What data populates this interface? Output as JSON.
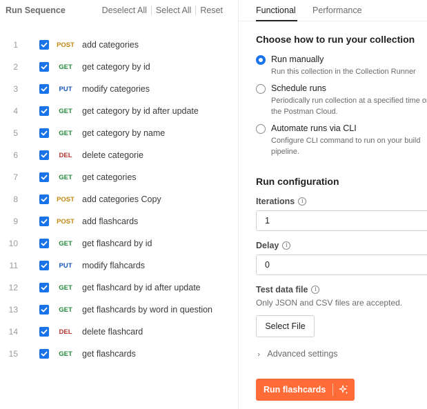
{
  "left": {
    "title": "Run Sequence",
    "deselect_all": "Deselect All",
    "select_all": "Select All",
    "reset": "Reset",
    "requests": [
      {
        "num": "1",
        "method": "POST",
        "name": "add categories"
      },
      {
        "num": "2",
        "method": "GET",
        "name": "get category by id"
      },
      {
        "num": "3",
        "method": "PUT",
        "name": "modify categories"
      },
      {
        "num": "4",
        "method": "GET",
        "name": "get category by id after update"
      },
      {
        "num": "5",
        "method": "GET",
        "name": "get category by name"
      },
      {
        "num": "6",
        "method": "DEL",
        "name": "delete categorie"
      },
      {
        "num": "7",
        "method": "GET",
        "name": "get categories"
      },
      {
        "num": "8",
        "method": "POST",
        "name": "add categories Copy"
      },
      {
        "num": "9",
        "method": "POST",
        "name": "add flashcards"
      },
      {
        "num": "10",
        "method": "GET",
        "name": "get flashcard by id"
      },
      {
        "num": "11",
        "method": "PUT",
        "name": "modify flahcards"
      },
      {
        "num": "12",
        "method": "GET",
        "name": "get flashcard by id after update"
      },
      {
        "num": "13",
        "method": "GET",
        "name": "get flashcards by word in question"
      },
      {
        "num": "14",
        "method": "DEL",
        "name": "delete flashcard"
      },
      {
        "num": "15",
        "method": "GET",
        "name": "get flashcards"
      }
    ]
  },
  "right": {
    "tabs": [
      "Functional",
      "Performance"
    ],
    "choose_title": "Choose how to run your collection",
    "options": [
      {
        "label": "Run manually",
        "desc": [
          "Run this collection in the Collection Runner"
        ],
        "selected": true
      },
      {
        "label": "Schedule runs",
        "desc": [
          "Periodically run collection at a specified time on",
          "the Postman Cloud."
        ],
        "selected": false
      },
      {
        "label": "Automate runs via CLI",
        "desc": [
          "Configure CLI command to run on your build",
          "pipeline."
        ],
        "selected": false
      }
    ],
    "config_title": "Run configuration",
    "iterations_label": "Iterations",
    "iterations_value": "1",
    "delay_label": "Delay",
    "delay_value": "0",
    "test_data_label": "Test data file",
    "test_data_help": "Only JSON and CSV files are accepted.",
    "select_file": "Select File",
    "advanced": "Advanced settings",
    "run_button": "Run flashcards"
  },
  "colors": {
    "accent_blue": "#1a73e8",
    "run_orange": "#ff6c37",
    "post": "#c48712",
    "get": "#248a3d",
    "put": "#1656b8",
    "del": "#b8322f"
  }
}
